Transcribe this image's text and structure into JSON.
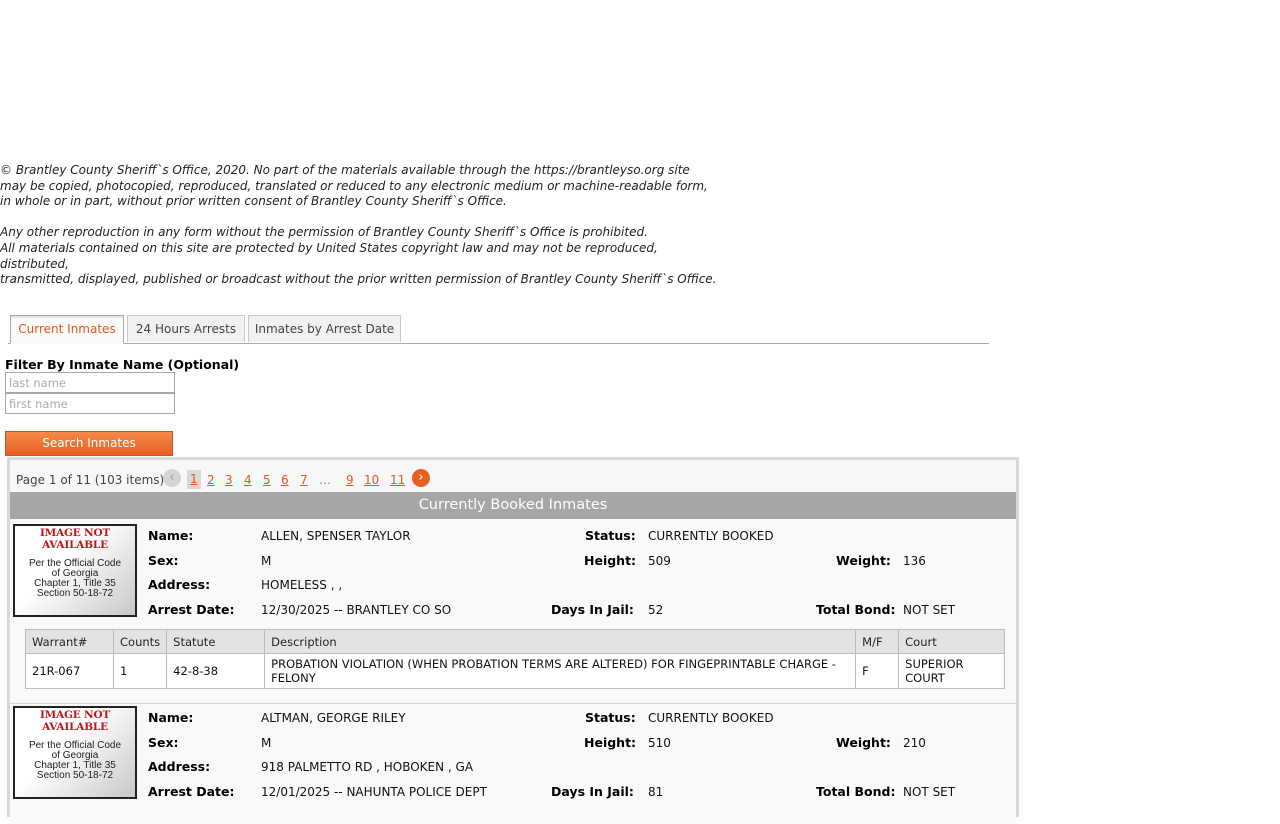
{
  "copyright": {
    "lines1": [
      "© Brantley County Sheriff`s Office, 2020. No part of the materials available through the https://brantleyso.org site",
      "may be copied, photocopied, reproduced, translated or reduced to any electronic medium or machine-readable form,",
      "in whole or in part, without prior written consent of Brantley County Sheriff`s Office."
    ],
    "lines2": [
      "Any other reproduction in any form without the permission of Brantley County Sheriff`s Office is prohibited.",
      "All materials contained on this site are protected by United States copyright law and may not be reproduced, distributed,",
      "transmitted, displayed, published or broadcast without the prior written permission of Brantley County Sheriff`s Office."
    ]
  },
  "tabs": [
    {
      "label": "Current Inmates",
      "active": true
    },
    {
      "label": "24 Hours Arrests",
      "active": false
    },
    {
      "label": "Inmates by Arrest Date",
      "active": false
    }
  ],
  "filter": {
    "label": "Filter By Inmate Name (Optional)",
    "last_name_placeholder": "last name",
    "first_name_placeholder": "first name",
    "search_button": "Search Inmates"
  },
  "pager": {
    "info": "Page 1 of 11 (103 items)",
    "prev_icon": "‹",
    "next_icon": "›",
    "pages": [
      "1",
      "2",
      "3",
      "4",
      "5",
      "6",
      "7",
      "…",
      "9",
      "10",
      "11"
    ],
    "current": "1"
  },
  "grid_title": "Currently Booked Inmates",
  "labels": {
    "name": "Name:",
    "status": "Status:",
    "sex": "Sex:",
    "height": "Height:",
    "weight": "Weight:",
    "address": "Address:",
    "arrest_date": "Arrest Date:",
    "days_in_jail": "Days In Jail:",
    "total_bond": "Total Bond:"
  },
  "photo_placeholder": {
    "title": "IMAGE NOT AVAILABLE",
    "lines": [
      "Per the Official Code",
      "of Georgia",
      "Chapter 1, Title 35",
      "Section 50-18-72"
    ]
  },
  "charge_headers": [
    "Warrant#",
    "Counts",
    "Statute",
    "Description",
    "M/F",
    "Court"
  ],
  "inmates": [
    {
      "name": "ALLEN, SPENSER TAYLOR",
      "status": "CURRENTLY BOOKED",
      "sex": "M",
      "height": "509",
      "weight": "136",
      "address": "HOMELESS , ,",
      "arrest_date": "12/30/2025 -- BRANTLEY CO SO",
      "days_in_jail": "52",
      "total_bond": "NOT SET",
      "charges": [
        {
          "warrant": "21R-067",
          "counts": "1",
          "statute": "42-8-38",
          "description": "PROBATION VIOLATION (WHEN PROBATION TERMS ARE ALTERED) FOR FINGEPRINTABLE CHARGE - FELONY",
          "mf": "F",
          "court": "SUPERIOR COURT"
        }
      ]
    },
    {
      "name": "ALTMAN, GEORGE RILEY",
      "status": "CURRENTLY BOOKED",
      "sex": "M",
      "height": "510",
      "weight": "210",
      "address": "918 PALMETTO RD , HOBOKEN , GA",
      "arrest_date": "12/01/2025 -- NAHUNTA POLICE DEPT",
      "days_in_jail": "81",
      "total_bond": "NOT SET",
      "charges": []
    }
  ]
}
